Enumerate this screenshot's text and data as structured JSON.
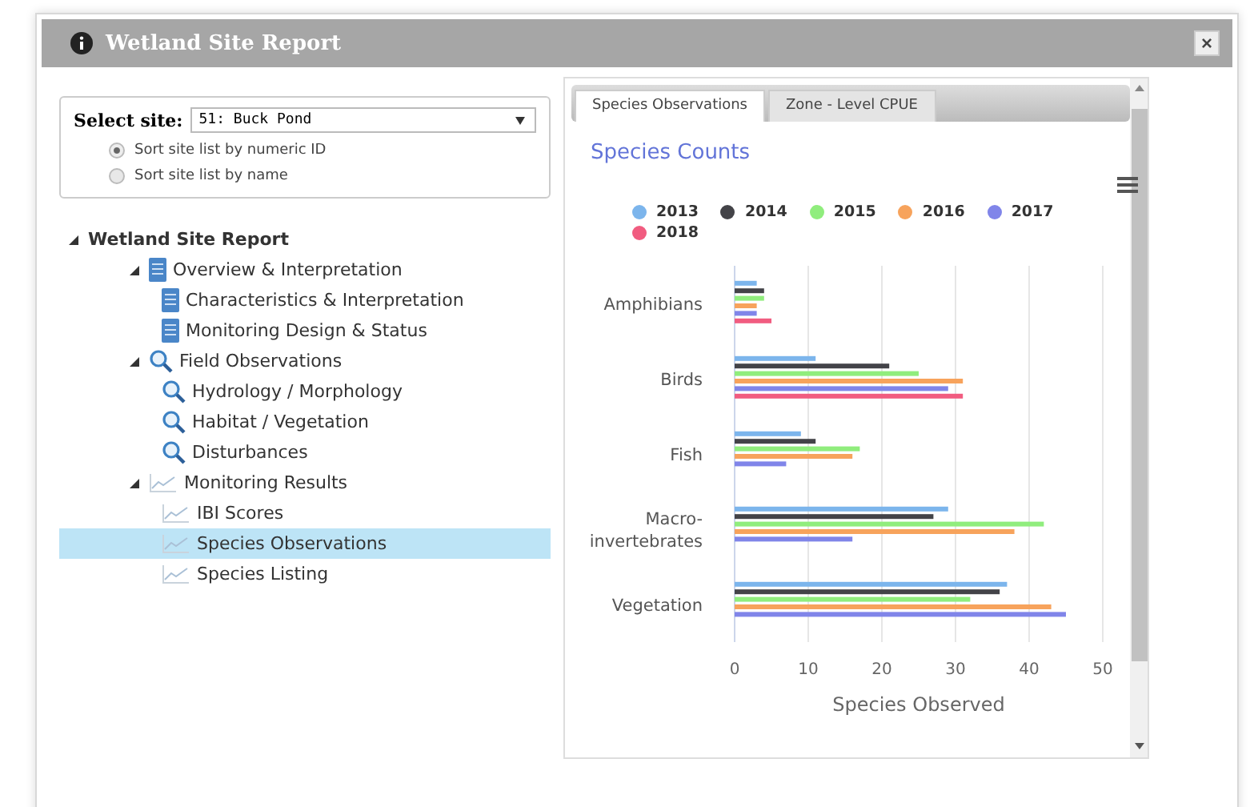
{
  "window": {
    "title": "Wetland Site Report",
    "close": "×"
  },
  "site_selector": {
    "label": "Select site:",
    "value": "51: Buck Pond",
    "sort_options": [
      {
        "label": "Sort site list by numeric ID",
        "selected": true
      },
      {
        "label": "Sort site list by name",
        "selected": false
      }
    ]
  },
  "tree": [
    {
      "label": "Wetland Site Report",
      "kind": "root",
      "expanded": true,
      "selected": false,
      "children": [
        {
          "label": "Overview & Interpretation",
          "kind": "document",
          "expanded": true,
          "selected": false,
          "children": [
            {
              "label": "Characteristics & Interpretation",
              "kind": "document",
              "selected": false
            },
            {
              "label": "Monitoring Design & Status",
              "kind": "document",
              "selected": false
            }
          ]
        },
        {
          "label": "Field Observations",
          "kind": "search",
          "expanded": true,
          "selected": false,
          "children": [
            {
              "label": "Hydrology / Morphology",
              "kind": "search",
              "selected": false
            },
            {
              "label": "Habitat / Vegetation",
              "kind": "search",
              "selected": false
            },
            {
              "label": "Disturbances",
              "kind": "search",
              "selected": false
            }
          ]
        },
        {
          "label": "Monitoring Results",
          "kind": "chart",
          "expanded": true,
          "selected": false,
          "children": [
            {
              "label": "IBI Scores",
              "kind": "chart",
              "selected": false
            },
            {
              "label": "Species Observations",
              "kind": "chart",
              "selected": true
            },
            {
              "label": "Species Listing",
              "kind": "chart",
              "selected": false
            }
          ]
        }
      ]
    }
  ],
  "tabs": [
    {
      "label": "Species Observations",
      "selected": true
    },
    {
      "label": "Zone - Level CPUE",
      "selected": false
    }
  ],
  "chart_data": {
    "type": "bar",
    "orientation": "horizontal",
    "title": "Species Counts",
    "xlabel": "Species Observed",
    "categories": [
      "Amphibians",
      "Birds",
      "Fish",
      "Macro-\ninvertebrates",
      "Vegetation"
    ],
    "xlim": [
      0,
      50
    ],
    "grid": true,
    "xticks": [
      0,
      10,
      20,
      30,
      40,
      50
    ],
    "series": [
      {
        "name": "2013",
        "color": "#7cb5ec",
        "values": [
          3,
          11,
          9,
          29,
          37
        ]
      },
      {
        "name": "2014",
        "color": "#434348",
        "values": [
          4,
          21,
          11,
          27,
          36
        ]
      },
      {
        "name": "2015",
        "color": "#90ed7d",
        "values": [
          4,
          25,
          17,
          42,
          32
        ]
      },
      {
        "name": "2016",
        "color": "#f7a35c",
        "values": [
          3,
          31,
          16,
          38,
          43
        ]
      },
      {
        "name": "2017",
        "color": "#8085e9",
        "values": [
          3,
          29,
          7,
          16,
          45
        ]
      },
      {
        "name": "2018",
        "color": "#f15c80",
        "values": [
          5,
          31,
          null,
          null,
          null
        ]
      }
    ]
  }
}
